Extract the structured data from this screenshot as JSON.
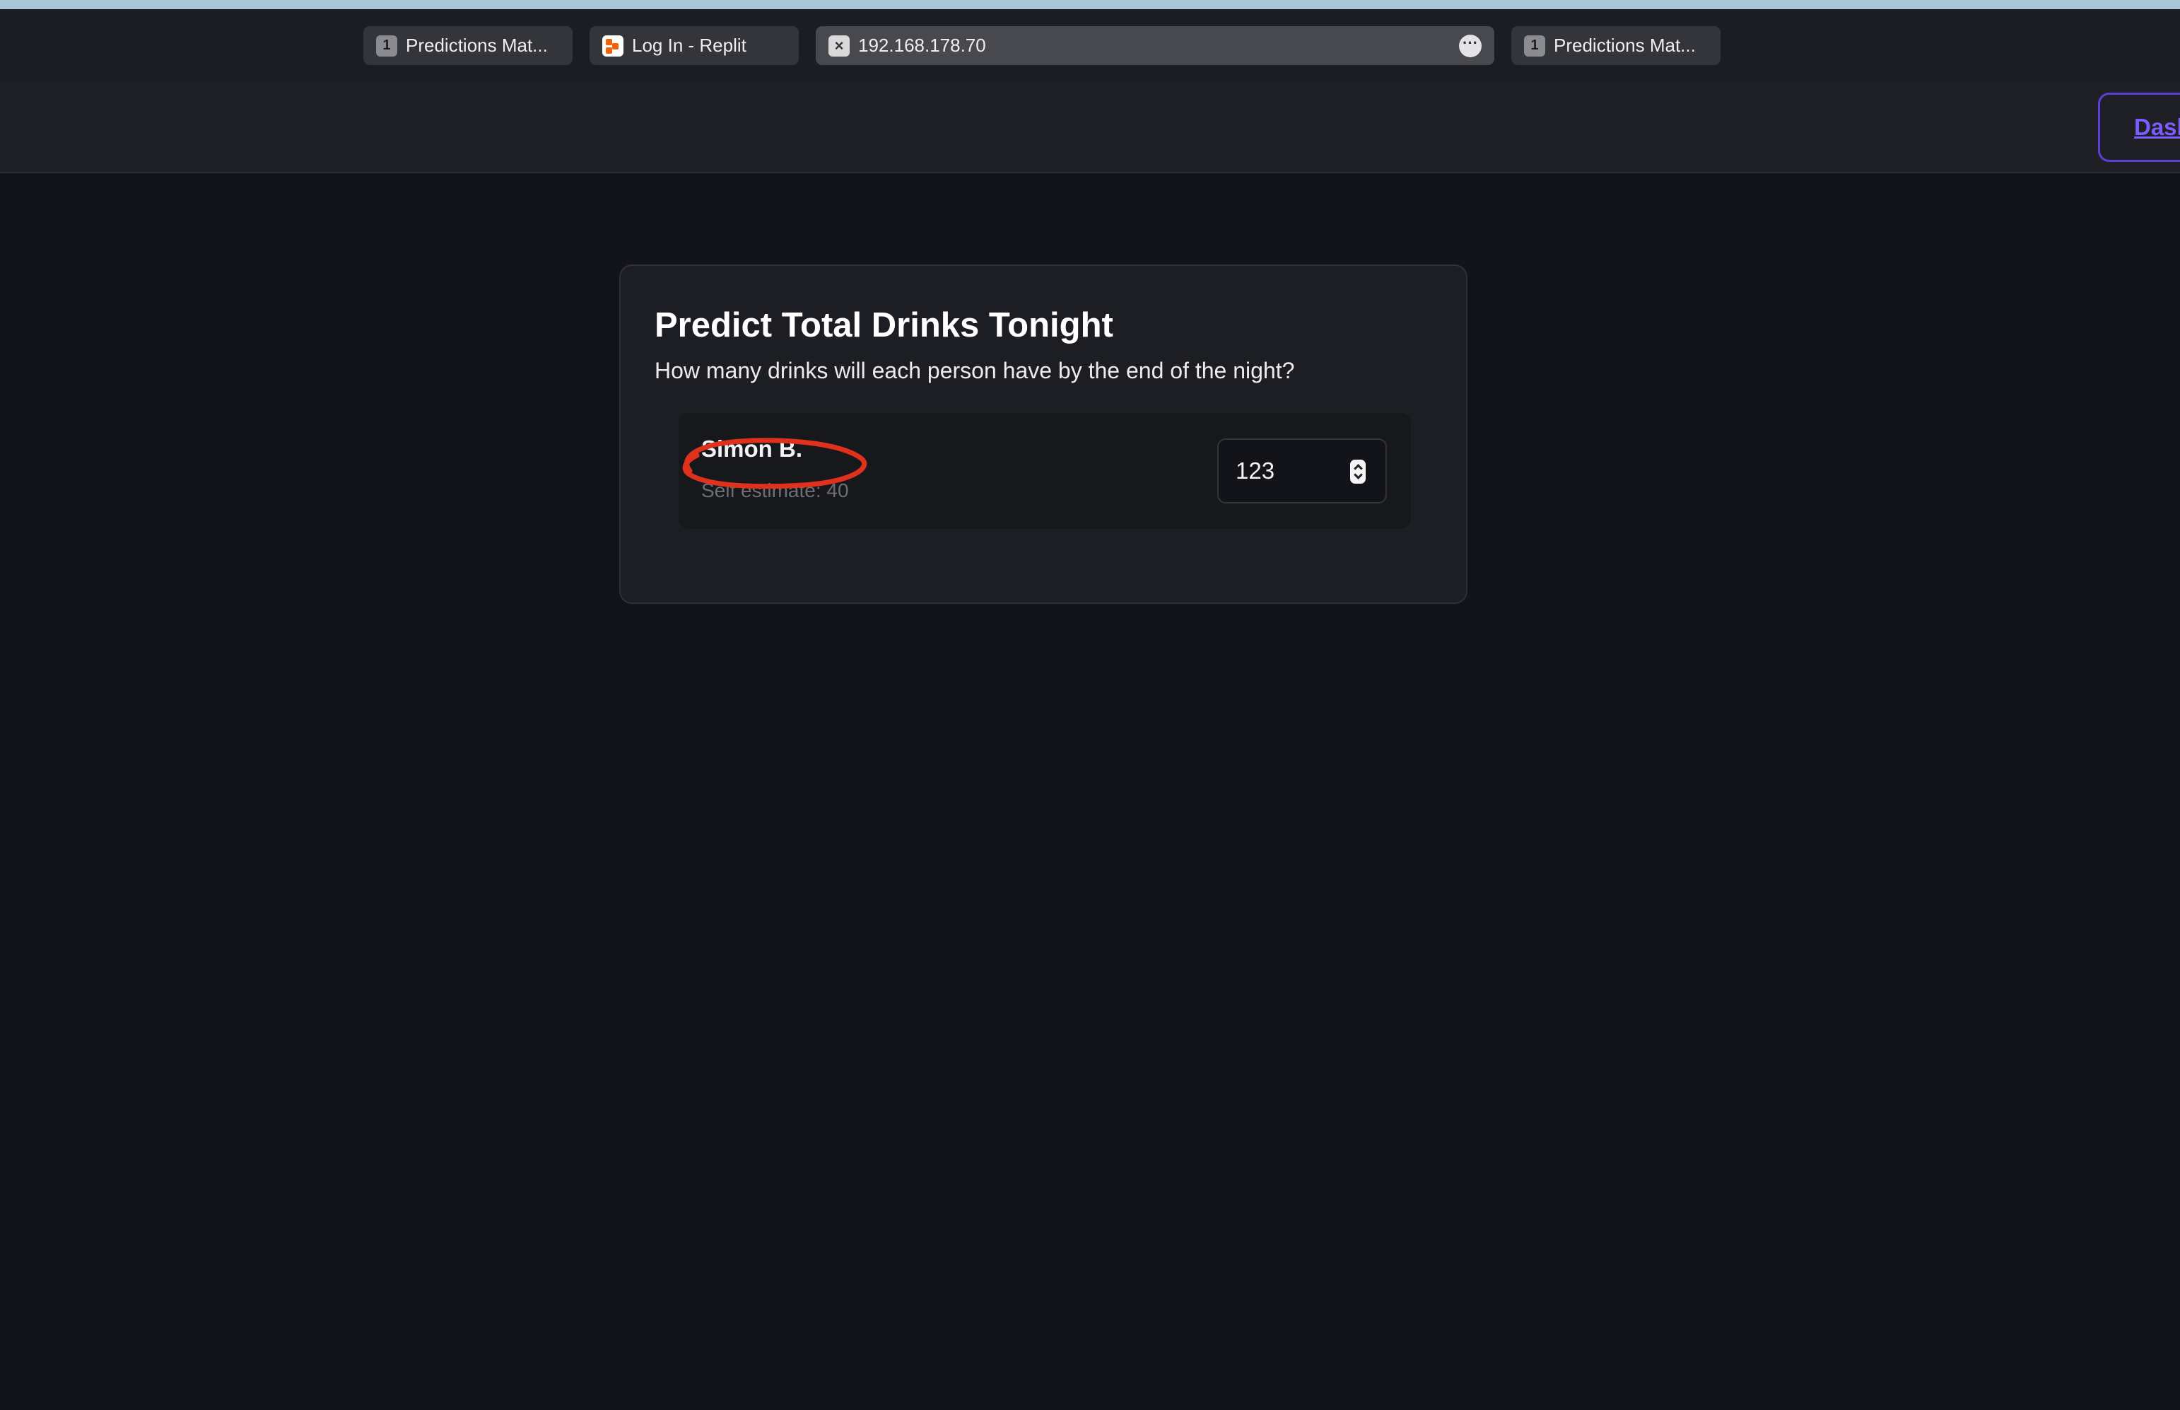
{
  "browser": {
    "tabs": [
      {
        "badge": "1",
        "label": "Predictions Mat..."
      },
      {
        "label": "Log In - Replit"
      },
      {
        "label": "192.168.178.70"
      },
      {
        "badge": "1",
        "label": "Predictions Mat..."
      }
    ]
  },
  "header": {
    "dashboard_label": "Dashboard"
  },
  "card": {
    "title": "Predict Total Drinks Tonight",
    "description": "How many drinks will each person have by the end of the night?",
    "people": [
      {
        "name": "Simon B.",
        "self_estimate": "Self estimate: 40",
        "prediction": "123"
      }
    ]
  },
  "colors": {
    "background": "#131419",
    "accent": "#7c5cff",
    "annotation": "#e0311d"
  }
}
